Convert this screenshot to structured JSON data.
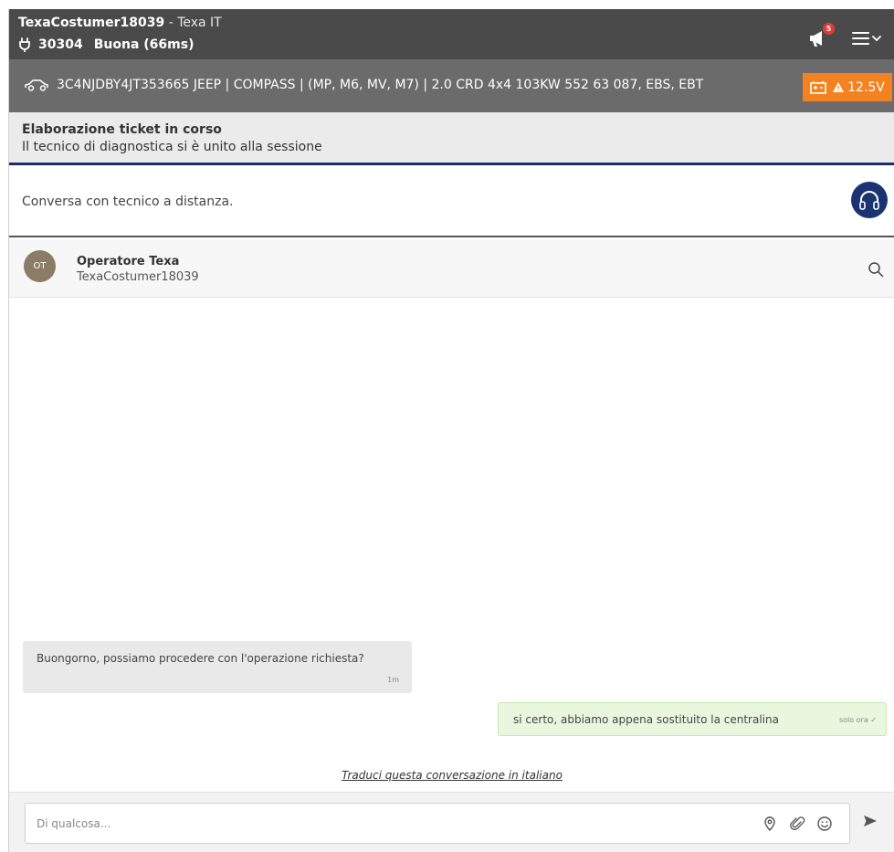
{
  "header": {
    "username": "TexaCostumer18039",
    "separator": " - ",
    "org": "Texa IT",
    "device_id": "30304",
    "connection_status": "Buona (66ms)",
    "notification_count": "5",
    "icons": [
      "plug-icon",
      "megaphone-icon",
      "hamburger-menu-icon",
      "chevron-down-icon"
    ]
  },
  "vehicle": {
    "info": "3C4NJDBY4JT353665  JEEP | COMPASS | (MP, M6, MV, M7) | 2.0 CRD 4x4 103KW 552 63 087, EBS, EBT",
    "battery_voltage": "12.5V",
    "icons": [
      "car-icon",
      "battery-icon",
      "warning-icon"
    ]
  },
  "ticket": {
    "title": "Elaborazione ticket in corso",
    "subtitle": "Il tecnico di diagnostica si è unito alla sessione"
  },
  "remote": {
    "text": "Conversa con tecnico a distanza.",
    "icon": "headset-icon"
  },
  "contact": {
    "initials": "OT",
    "name": "Operatore Texa",
    "handle": "TexaCostumer18039"
  },
  "messages": [
    {
      "direction": "incoming",
      "text": "Buongorno, possiamo procedere con l'operazione richiesta?",
      "time": "1m"
    },
    {
      "direction": "outgoing",
      "text": "si certo, abbiamo appena sostituito la centralina",
      "time": "solo ora ✓"
    }
  ],
  "translate_link": "Traduci questa conversazione in italiano",
  "compose": {
    "placeholder": "Di qualcosa..."
  },
  "colors": {
    "header_bg": "#4a4a4a",
    "vehicle_bg": "#6b6b6b",
    "battery_orange": "#f58220",
    "accent_navy": "#1a3473",
    "avatar_bg": "#8a7c66",
    "outgoing_bubble": "#eaf7df"
  }
}
